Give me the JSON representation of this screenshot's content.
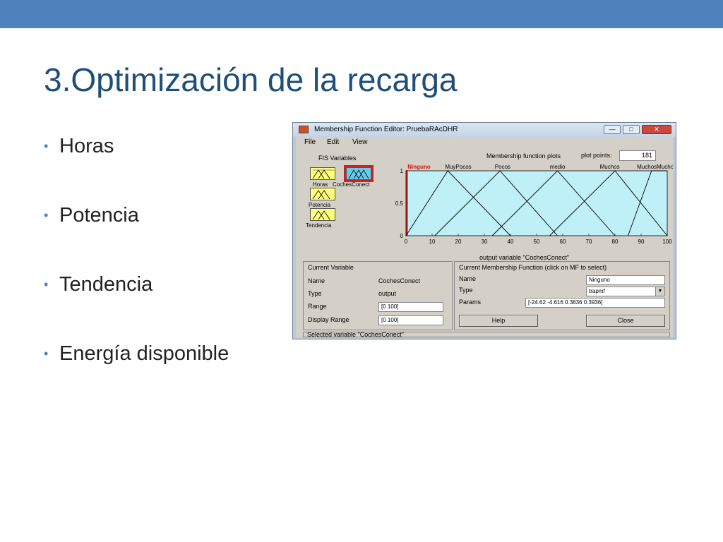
{
  "slide": {
    "title": "3.Optimización de la recarga",
    "bullets": [
      "Horas",
      "Potencia",
      "Tendencia",
      "Energía disponible"
    ],
    "bullet_glyph": "•",
    "accent_color": "#4f81bd",
    "title_color": "#1f4e79"
  },
  "window": {
    "title": "Membership Function Editor: PruebaRAcDHR",
    "buttons": {
      "minimize": "—",
      "maximize": "□",
      "close": "✕"
    },
    "menu": [
      "File",
      "Edit",
      "View"
    ],
    "fis_variables_label": "FIS Variables",
    "fis_variables": [
      "Horas",
      "CochesConect",
      "Potencia",
      "Tendencia"
    ],
    "selected_variable": "CochesConect",
    "mf_plots_label": "Membership function plots",
    "plot_points_label": "plot points:",
    "plot_points_value": "181"
  },
  "chart_data": {
    "type": "line",
    "xlabel": "output variable \"CochesConect\"",
    "xlim": [
      0,
      100
    ],
    "ylim": [
      0,
      1
    ],
    "x_ticks": [
      0,
      10,
      20,
      30,
      40,
      50,
      60,
      70,
      80,
      90,
      100
    ],
    "y_ticks": [
      "0",
      "0.5",
      "1"
    ],
    "background": "#bfeff7",
    "series": [
      {
        "name": "Ninguno",
        "points": [
          [
            0,
            1
          ],
          [
            0.4,
            1
          ],
          [
            0.4,
            0
          ]
        ],
        "color": "#d01010"
      },
      {
        "name": "MuyPocos",
        "points": [
          [
            0,
            0
          ],
          [
            16,
            1
          ],
          [
            40,
            0
          ]
        ]
      },
      {
        "name": "Pocos",
        "points": [
          [
            11,
            0
          ],
          [
            36,
            1
          ],
          [
            58,
            0
          ]
        ]
      },
      {
        "name": "medio",
        "points": [
          [
            33,
            0
          ],
          [
            58,
            1
          ],
          [
            80,
            0
          ]
        ]
      },
      {
        "name": "Muchos",
        "points": [
          [
            55,
            0
          ],
          [
            80,
            1
          ],
          [
            100,
            0
          ]
        ]
      },
      {
        "name": "MuchosMuchos",
        "points": [
          [
            85,
            0
          ],
          [
            94,
            1
          ],
          [
            100,
            1
          ]
        ]
      }
    ],
    "label_x": [
      5,
      20,
      37,
      58,
      78,
      96
    ]
  },
  "current_variable": {
    "heading": "Current Variable",
    "name_label": "Name",
    "name_value": "CochesConect",
    "type_label": "Type",
    "type_value": "output",
    "range_label": "Range",
    "range_value": "[0 100]",
    "display_range_label": "Display Range",
    "display_range_value": "[0 100]"
  },
  "current_mf": {
    "heading": "Current Membership Function (click on MF to select)",
    "name_label": "Name",
    "name_value": "Ninguno",
    "type_label": "Type",
    "type_value": "trapmf",
    "params_label": "Params",
    "params_value": "[-24.62 -4.616 0.3836 0.3936]",
    "help_label": "Help",
    "close_label": "Close"
  },
  "status": {
    "text": "Selected variable \"CochesConect\""
  }
}
